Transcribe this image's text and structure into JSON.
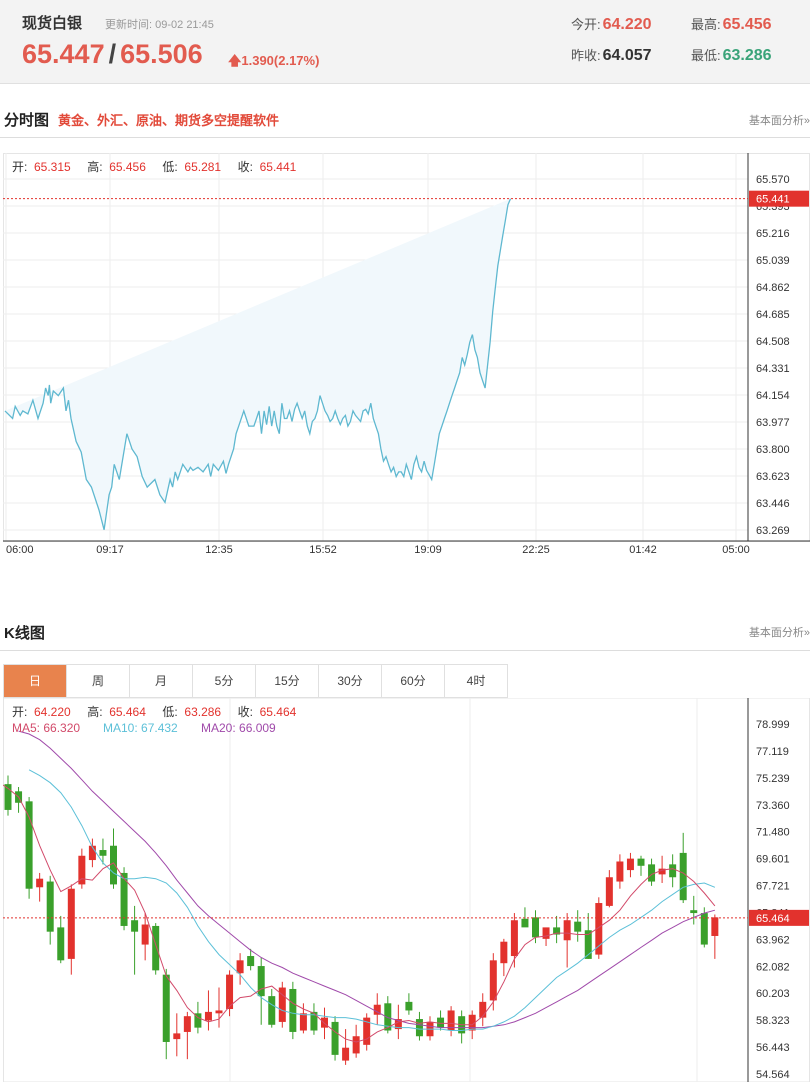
{
  "quote": {
    "name": "现货白银",
    "update_label": "更新时间:",
    "update_time": "09-02 21:45",
    "bid": "65.447",
    "sep": "/",
    "ask": "65.506",
    "change": "1.390(2.17%)",
    "open_label": "今开:",
    "open": "64.220",
    "high_label": "最高:",
    "high": "65.456",
    "prev_close_label": "昨收:",
    "prev_close": "64.057",
    "low_label": "最低:",
    "low": "63.286"
  },
  "intraday_section": {
    "title": "分时图",
    "link": "黄金、外汇、原油、期货多空提醒软件",
    "right_link": "基本面分析»"
  },
  "kline_section": {
    "title": "K线图",
    "right_link": "基本面分析»",
    "tabs": [
      {
        "label": "日",
        "active": true
      },
      {
        "label": "周"
      },
      {
        "label": "月"
      },
      {
        "label": "5分"
      },
      {
        "label": "15分"
      },
      {
        "label": "30分"
      },
      {
        "label": "60分"
      },
      {
        "label": "4时"
      }
    ]
  },
  "colors": {
    "up": "#e2322d",
    "down": "#3aa02b",
    "line": "#5fb8d0",
    "ma5": "#d24a6a",
    "ma10": "#5cc0d8",
    "ma20": "#a04aaa"
  },
  "chart_data": [
    {
      "type": "line",
      "title": "分时图",
      "info": [
        {
          "label": "开:",
          "value": "65.315"
        },
        {
          "label": "高:",
          "value": "65.456"
        },
        {
          "label": "低:",
          "value": "65.281"
        },
        {
          "label": "收:",
          "value": "65.441"
        }
      ],
      "current_value": "65.441",
      "yticks": [
        "65.570",
        "65.393",
        "65.216",
        "65.039",
        "64.862",
        "64.685",
        "64.508",
        "64.331",
        "64.154",
        "63.977",
        "63.800",
        "63.623",
        "63.446",
        "63.269"
      ],
      "ylim": [
        63.269,
        65.57
      ],
      "xticks": [
        "06:00",
        "09:17",
        "12:35",
        "15:52",
        "19:09",
        "22:25",
        "01:42",
        "05:00"
      ],
      "x_unit": "minutes after 06:00",
      "xlim": [
        0,
        1380
      ],
      "x": [
        0,
        30,
        40,
        60,
        70,
        90,
        110,
        130,
        150,
        160,
        170,
        175,
        180,
        190,
        210,
        230,
        240,
        250,
        260,
        280,
        300,
        320,
        340,
        370,
        390,
        410,
        420,
        430,
        450,
        480,
        500,
        520,
        540,
        560,
        590,
        610,
        630,
        650,
        660,
        670,
        680,
        690,
        700,
        720,
        730,
        740,
        760,
        780,
        800,
        810,
        820,
        840,
        860,
        870,
        880,
        900,
        910,
        920,
        940,
        960,
        980,
        990,
        1000,
        1010,
        1020,
        1030,
        1040,
        1050,
        1060,
        1070,
        1080,
        1090,
        1100,
        1110,
        1120,
        1130,
        1140,
        1150,
        1160,
        1170,
        1180,
        1190,
        1200,
        1210,
        1220,
        1230,
        1240,
        1250,
        1260,
        1270,
        1280,
        1290,
        1300,
        1310,
        1320,
        1330,
        1340,
        1350,
        1360,
        1370,
        1380,
        1390,
        1400,
        1410,
        1420,
        1430,
        1440,
        1450,
        1460,
        1470,
        1480,
        1490,
        1500,
        1510,
        1520,
        1530,
        1540,
        1550,
        1560,
        1570,
        1580,
        1590,
        1600,
        1610,
        1620,
        1630,
        1640,
        1650,
        1660,
        1670,
        1680,
        1690,
        1700,
        1710,
        1720,
        1730,
        1740,
        1750,
        1760,
        1770,
        1780,
        1790,
        1800,
        1810,
        1820,
        1830,
        1840,
        1850,
        1860,
        1870,
        1880,
        1890,
        1900,
        1910,
        1920,
        1930,
        1940,
        1950,
        1960,
        1970,
        1980,
        1990,
        2000
      ],
      "y_note": "trace drawn from sampled shape",
      "y": [
        64.05,
        64.0,
        64.08,
        64.02,
        64.05,
        64.03,
        64.12,
        64.0,
        64.1,
        64.2,
        64.15,
        64.22,
        64.1,
        64.18,
        64.15,
        64.2,
        64.05,
        64.12,
        64.0,
        63.85,
        63.78,
        63.6,
        63.55,
        63.4,
        63.27,
        63.5,
        63.55,
        63.7,
        63.6,
        63.9,
        63.8,
        63.75,
        63.62,
        63.55,
        63.6,
        63.5,
        63.45,
        63.6,
        63.55,
        63.65,
        63.6,
        63.65,
        63.7,
        63.65,
        63.68,
        63.66,
        63.68,
        63.65,
        63.7,
        63.62,
        63.7,
        63.66,
        63.72,
        63.64,
        63.7,
        63.8,
        63.9,
        63.95,
        64.05,
        63.95,
        63.95,
        64.0,
        64.05,
        63.9,
        64.05,
        63.96,
        64.08,
        63.95,
        64.05,
        63.95,
        63.9,
        64.1,
        64.0,
        64.0,
        64.05,
        63.98,
        64.06,
        64.1,
        64.05,
        64.0,
        64.05,
        63.95,
        63.9,
        63.98,
        64.0,
        64.05,
        64.15,
        64.1,
        64.05,
        64.02,
        63.98,
        64.0,
        64.05,
        64.0,
        63.96,
        64.0,
        64.02,
        63.95,
        63.98,
        64.05,
        64.02,
        64.0,
        63.98,
        64.05,
        64.06,
        64.03,
        64.1,
        64.0,
        63.95,
        63.9,
        63.8,
        63.72,
        63.75,
        63.7,
        63.65,
        63.68,
        63.62,
        63.65,
        63.65,
        63.62,
        63.7,
        63.65,
        63.6,
        63.7,
        63.75,
        63.68,
        63.65,
        63.72,
        63.66,
        63.63,
        63.6,
        63.7,
        63.8,
        63.9,
        63.95,
        64.0,
        64.05,
        64.1,
        64.15,
        64.2,
        64.25,
        64.3,
        64.4,
        64.35,
        64.42,
        64.5,
        64.55,
        64.45,
        64.4,
        64.3,
        64.25,
        64.2,
        64.35,
        64.5,
        64.7,
        64.85,
        65.0,
        65.1,
        65.2,
        65.3,
        65.4,
        65.44
      ]
    },
    {
      "type": "candlestick",
      "title": "K线图",
      "info": [
        {
          "label": "开:",
          "value": "64.220"
        },
        {
          "label": "高:",
          "value": "65.464"
        },
        {
          "label": "低:",
          "value": "63.286"
        },
        {
          "label": "收:",
          "value": "65.464"
        }
      ],
      "ma_info": [
        {
          "label": "MA5:",
          "value": "66.320"
        },
        {
          "label": "MA10:",
          "value": "67.432"
        },
        {
          "label": "MA20:",
          "value": "66.009"
        }
      ],
      "current_value": "65.464",
      "yticks": [
        "78.999",
        "77.119",
        "75.239",
        "73.360",
        "71.480",
        "69.601",
        "67.721",
        "65.841",
        "63.962",
        "62.082",
        "60.203",
        "58.323",
        "56.443",
        "54.564"
      ],
      "ylim": [
        54.564,
        80.0
      ],
      "candles": [
        {
          "o": 74.8,
          "h": 75.4,
          "l": 72.6,
          "c": 73.0
        },
        {
          "o": 74.3,
          "h": 74.6,
          "l": 72.8,
          "c": 73.5
        },
        {
          "o": 73.6,
          "h": 73.9,
          "l": 66.8,
          "c": 67.5
        },
        {
          "o": 67.6,
          "h": 68.6,
          "l": 66.6,
          "c": 68.2
        },
        {
          "o": 68.0,
          "h": 68.4,
          "l": 63.6,
          "c": 64.5
        },
        {
          "o": 64.8,
          "h": 65.6,
          "l": 62.3,
          "c": 62.5
        },
        {
          "o": 62.6,
          "h": 67.8,
          "l": 61.5,
          "c": 67.5
        },
        {
          "o": 67.8,
          "h": 70.3,
          "l": 67.5,
          "c": 69.8
        },
        {
          "o": 69.5,
          "h": 71.0,
          "l": 69.0,
          "c": 70.5
        },
        {
          "o": 70.2,
          "h": 71.0,
          "l": 69.2,
          "c": 69.8
        },
        {
          "o": 70.5,
          "h": 71.7,
          "l": 67.5,
          "c": 67.8
        },
        {
          "o": 68.6,
          "h": 69.0,
          "l": 64.6,
          "c": 64.9
        },
        {
          "o": 65.3,
          "h": 66.3,
          "l": 61.5,
          "c": 64.5
        },
        {
          "o": 63.6,
          "h": 65.8,
          "l": 62.5,
          "c": 65.0
        },
        {
          "o": 64.9,
          "h": 65.1,
          "l": 61.5,
          "c": 61.8
        },
        {
          "o": 61.5,
          "h": 61.9,
          "l": 55.6,
          "c": 56.8
        },
        {
          "o": 57.0,
          "h": 58.8,
          "l": 55.8,
          "c": 57.4
        },
        {
          "o": 57.5,
          "h": 58.9,
          "l": 55.6,
          "c": 58.6
        },
        {
          "o": 58.8,
          "h": 59.6,
          "l": 57.4,
          "c": 57.8
        },
        {
          "o": 58.3,
          "h": 60.4,
          "l": 57.6,
          "c": 58.9
        },
        {
          "o": 58.8,
          "h": 60.6,
          "l": 57.8,
          "c": 59.0
        },
        {
          "o": 59.1,
          "h": 61.8,
          "l": 58.6,
          "c": 61.5
        },
        {
          "o": 61.6,
          "h": 63.0,
          "l": 60.8,
          "c": 62.5
        },
        {
          "o": 62.8,
          "h": 63.3,
          "l": 61.8,
          "c": 62.1
        },
        {
          "o": 62.1,
          "h": 62.7,
          "l": 58.0,
          "c": 60.0
        },
        {
          "o": 60.0,
          "h": 60.5,
          "l": 57.8,
          "c": 58.0
        },
        {
          "o": 58.2,
          "h": 61.0,
          "l": 57.8,
          "c": 60.6
        },
        {
          "o": 60.5,
          "h": 61.0,
          "l": 57.0,
          "c": 57.5
        },
        {
          "o": 57.6,
          "h": 59.5,
          "l": 57.4,
          "c": 58.8
        },
        {
          "o": 58.9,
          "h": 59.5,
          "l": 57.3,
          "c": 57.6
        },
        {
          "o": 57.8,
          "h": 59.2,
          "l": 57.0,
          "c": 58.5
        },
        {
          "o": 58.2,
          "h": 58.6,
          "l": 55.5,
          "c": 55.9
        },
        {
          "o": 55.5,
          "h": 57.7,
          "l": 55.2,
          "c": 56.4
        },
        {
          "o": 56.0,
          "h": 58.0,
          "l": 55.7,
          "c": 57.2
        },
        {
          "o": 56.6,
          "h": 58.8,
          "l": 56.2,
          "c": 58.5
        },
        {
          "o": 58.7,
          "h": 60.2,
          "l": 58.0,
          "c": 59.4
        },
        {
          "o": 59.5,
          "h": 60.0,
          "l": 57.4,
          "c": 57.6
        },
        {
          "o": 57.7,
          "h": 59.4,
          "l": 57.0,
          "c": 58.4
        },
        {
          "o": 59.6,
          "h": 60.2,
          "l": 58.7,
          "c": 59.0
        },
        {
          "o": 58.4,
          "h": 58.9,
          "l": 56.9,
          "c": 57.2
        },
        {
          "o": 57.2,
          "h": 58.6,
          "l": 56.9,
          "c": 58.2
        },
        {
          "o": 58.5,
          "h": 59.0,
          "l": 57.6,
          "c": 57.8
        },
        {
          "o": 57.6,
          "h": 59.3,
          "l": 57.2,
          "c": 59.0
        },
        {
          "o": 58.6,
          "h": 59.0,
          "l": 56.7,
          "c": 57.4
        },
        {
          "o": 57.6,
          "h": 59.0,
          "l": 57.0,
          "c": 58.7
        },
        {
          "o": 58.5,
          "h": 60.2,
          "l": 57.9,
          "c": 59.6
        },
        {
          "o": 59.7,
          "h": 63.0,
          "l": 59.0,
          "c": 62.5
        },
        {
          "o": 62.3,
          "h": 64.0,
          "l": 61.4,
          "c": 63.8
        },
        {
          "o": 62.8,
          "h": 65.8,
          "l": 62.0,
          "c": 65.3
        },
        {
          "o": 65.4,
          "h": 66.2,
          "l": 64.9,
          "c": 64.8
        },
        {
          "o": 65.5,
          "h": 66.0,
          "l": 63.7,
          "c": 64.1
        },
        {
          "o": 64.0,
          "h": 64.6,
          "l": 63.5,
          "c": 64.8
        },
        {
          "o": 64.8,
          "h": 65.6,
          "l": 63.7,
          "c": 64.3
        },
        {
          "o": 63.9,
          "h": 65.8,
          "l": 62.0,
          "c": 65.3
        },
        {
          "o": 65.2,
          "h": 66.0,
          "l": 63.8,
          "c": 64.5
        },
        {
          "o": 64.6,
          "h": 65.8,
          "l": 62.6,
          "c": 62.6
        },
        {
          "o": 62.9,
          "h": 66.9,
          "l": 62.6,
          "c": 66.5
        },
        {
          "o": 66.3,
          "h": 68.8,
          "l": 66.2,
          "c": 68.3
        },
        {
          "o": 68.0,
          "h": 69.9,
          "l": 67.5,
          "c": 69.4
        },
        {
          "o": 68.8,
          "h": 70.0,
          "l": 68.3,
          "c": 69.6
        },
        {
          "o": 69.6,
          "h": 69.8,
          "l": 68.4,
          "c": 69.1
        },
        {
          "o": 69.2,
          "h": 69.6,
          "l": 67.7,
          "c": 68.0
        },
        {
          "o": 68.5,
          "h": 69.8,
          "l": 67.9,
          "c": 68.9
        },
        {
          "o": 69.2,
          "h": 69.9,
          "l": 67.6,
          "c": 68.3
        },
        {
          "o": 70.0,
          "h": 71.4,
          "l": 66.5,
          "c": 66.7
        },
        {
          "o": 66.0,
          "h": 67.0,
          "l": 65.0,
          "c": 65.8
        },
        {
          "o": 65.8,
          "h": 66.2,
          "l": 63.4,
          "c": 63.6
        },
        {
          "o": 64.2,
          "h": 65.7,
          "l": 62.6,
          "c": 65.5
        }
      ],
      "ma5": [
        75.0,
        74.5,
        73.9,
        72.5,
        70.5,
        68.8,
        67.3,
        67.7,
        68.2,
        68.1,
        68.9,
        69.3,
        68.2,
        67.4,
        65.8,
        63.6,
        61.4,
        60.4,
        59.2,
        58.5,
        58.2,
        58.4,
        59.3,
        59.9,
        60.0,
        60.5,
        60.7,
        60.1,
        59.5,
        59.1,
        58.8,
        58.1,
        57.5,
        57.0,
        56.8,
        57.0,
        57.5,
        57.8,
        58.2,
        58.3,
        58.1,
        58.2,
        58.1,
        58.1,
        58.0,
        58.0,
        58.6,
        59.6,
        61.0,
        62.6,
        63.6,
        64.1,
        64.2,
        64.4,
        64.4,
        64.3,
        64.3,
        64.8,
        65.3,
        66.0,
        67.0,
        67.8,
        68.5,
        68.8,
        68.9,
        68.6,
        68.0,
        67.2,
        66.3
      ],
      "ma10": [
        75.8,
        75.4,
        74.9,
        74.2,
        73.2,
        71.9,
        70.4,
        69.3,
        68.6,
        68.2,
        68.2,
        68.3,
        68.2,
        67.9,
        67.2,
        66.2,
        64.9,
        63.8,
        62.9,
        62.2,
        61.5,
        60.6,
        59.9,
        59.4,
        59.0,
        58.8,
        58.7,
        58.7,
        58.6,
        58.5,
        58.5,
        58.4,
        58.2,
        58.0,
        57.9,
        57.8,
        57.8,
        57.7,
        57.7,
        57.7,
        57.6,
        57.6,
        57.7,
        57.7,
        57.9,
        58.2,
        58.6,
        59.2,
        59.9,
        60.6,
        61.3,
        61.8,
        62.3,
        62.9,
        63.5,
        64.1,
        64.6,
        65.0,
        65.5,
        66.0,
        66.6,
        67.1,
        67.6,
        67.8,
        67.9,
        67.6
      ],
      "ma20": [
        78.5,
        78.3,
        77.9,
        77.3,
        76.6,
        75.9,
        75.1,
        74.3,
        73.6,
        72.9,
        72.2,
        71.5,
        70.8,
        70.0,
        69.1,
        68.1,
        67.2,
        66.3,
        65.6,
        65.0,
        64.4,
        63.8,
        63.2,
        62.7,
        62.3,
        62.0,
        61.6,
        61.3,
        61.0,
        60.7,
        60.4,
        60.1,
        59.7,
        59.3,
        58.9,
        58.5,
        58.3,
        58.1,
        58.0,
        57.9,
        57.8,
        57.8,
        57.8,
        57.8,
        57.8,
        57.9,
        58.0,
        58.2,
        58.5,
        58.8,
        59.2,
        59.6,
        60.0,
        60.4,
        60.9,
        61.4,
        61.9,
        62.4,
        62.9,
        63.4,
        63.9,
        64.4,
        64.8,
        65.2,
        65.5,
        65.8,
        66.0
      ]
    }
  ]
}
